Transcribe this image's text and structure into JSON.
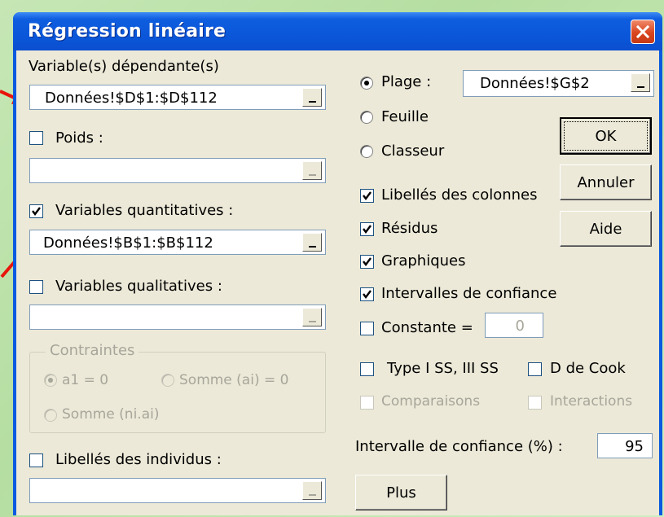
{
  "window": {
    "title": "Régression linéaire"
  },
  "left": {
    "dependent_label": "Variable(s) dépendante(s)",
    "dependent_value": "Données!$D$1:$D$112",
    "weights_label": "Poids :",
    "weights_value": "",
    "quant_label": "Variables quantitatives :",
    "quant_value": "Données!$B$1:$B$112",
    "qual_label": "Variables qualitatives :",
    "qual_value": "",
    "constraints_title": "Contraintes",
    "constraint_a1": "a1 = 0",
    "constraint_sum_ai": "Somme (ai) = 0",
    "constraint_sum_niai": "Somme (ni.ai)",
    "obs_labels_label": "Libellés des individus :",
    "obs_labels_value": ""
  },
  "right": {
    "range_label": "Plage :",
    "range_value": "Données!$G$2",
    "sheet_label": "Feuille",
    "workbook_label": "Classeur",
    "col_labels": "Libellés des colonnes",
    "residuals": "Résidus",
    "charts": "Graphiques",
    "conf_intervals": "Intervalles de confiance",
    "constant_label": "Constante =",
    "constant_value": "0",
    "type_ss": "Type I SS, III SS",
    "cook": "D de Cook",
    "comparisons": "Comparaisons",
    "interactions": "Interactions",
    "ci_label": "Intervalle de confiance (%) :",
    "ci_value": "95"
  },
  "buttons": {
    "ok": "OK",
    "cancel": "Annuler",
    "help": "Aide",
    "more": "Plus"
  },
  "colors": {
    "titlebar": "#0a55d8",
    "dialog_bg": "#ece9d8",
    "close": "#d9451e",
    "annotation_arrow": "#e8140c"
  },
  "icons": {
    "close": "close-icon",
    "check": "checkmark-icon",
    "picker": "range-picker-icon",
    "arrow": "red-arrow-icon"
  }
}
